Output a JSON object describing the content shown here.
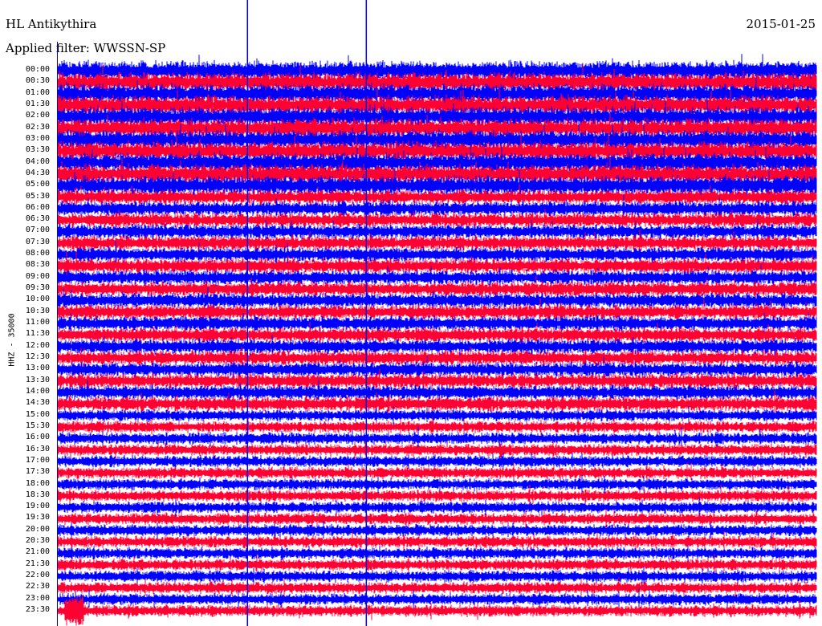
{
  "header": {
    "station": "HL Antikythira",
    "date": "2015-01-25",
    "filter": "Applied filter: WWSSN-SP"
  },
  "chart_data": {
    "type": "line",
    "title": "HL Antikythira",
    "ylabel": "HHZ - 35000",
    "row_labels": [
      "00:00",
      "00:30",
      "01:00",
      "01:30",
      "02:00",
      "02:30",
      "03:00",
      "03:30",
      "04:00",
      "04:30",
      "05:00",
      "05:30",
      "06:00",
      "06:30",
      "07:00",
      "07:30",
      "08:00",
      "08:30",
      "09:00",
      "09:30",
      "10:00",
      "10:30",
      "11:00",
      "11:30",
      "12:00",
      "12:30",
      "13:00",
      "13:30",
      "14:00",
      "14:30",
      "15:00",
      "15:30",
      "16:00",
      "16:30",
      "17:00",
      "17:30",
      "18:00",
      "18:30",
      "19:00",
      "19:30",
      "20:00",
      "20:30",
      "21:00",
      "21:30",
      "22:00",
      "22:30",
      "23:00",
      "23:30"
    ],
    "row_colors": [
      "#0000ff",
      "#ff0033"
    ],
    "minutes_per_row": 30,
    "marker_minutes": [
      7.5,
      12.2
    ],
    "marker_color": "#0000ff"
  }
}
